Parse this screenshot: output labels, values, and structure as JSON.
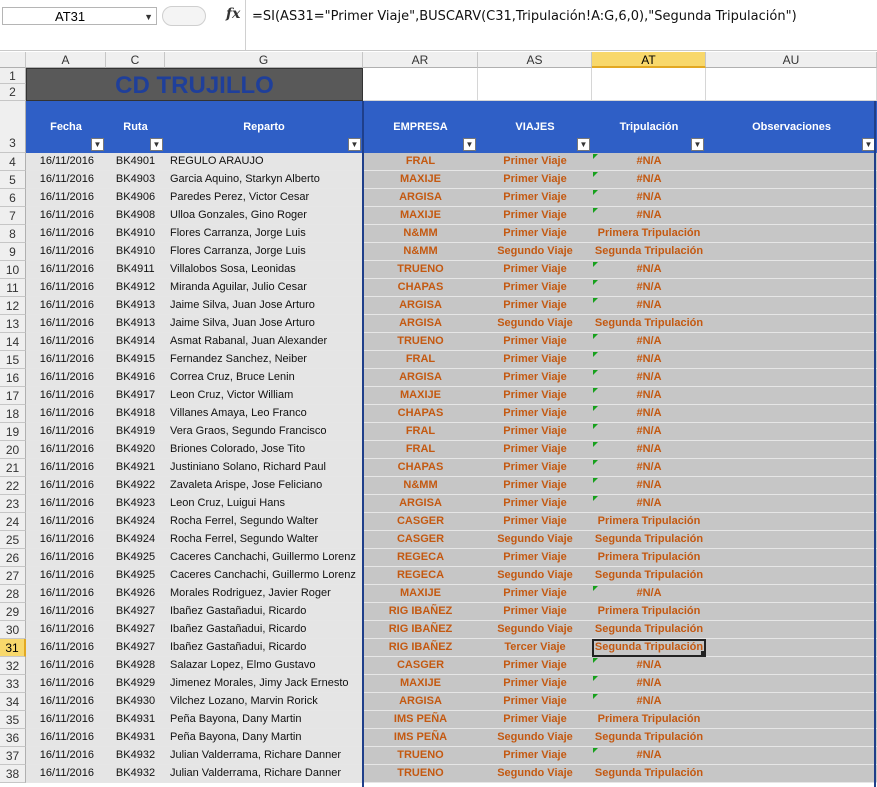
{
  "formula_bar": {
    "name_box": "AT31",
    "fx": "fx",
    "formula": "=SI(AS31=\"Primer Viaje\",BUSCARV(C31,Tripulación!A:G,6,0),\"Segunda Tripulación\")"
  },
  "columns": [
    "A",
    "C",
    "G",
    "AR",
    "AS",
    "AT",
    "AU"
  ],
  "active_column": "AT",
  "active_row": 31,
  "title": "CD TRUJILLO",
  "headers": {
    "fecha": "Fecha",
    "ruta": "Ruta",
    "reparto": "Reparto",
    "empresa": "EMPRESA",
    "viajes": "VIAJES",
    "tripulacion": "Tripulación",
    "observaciones": "Observaciones"
  },
  "filter_arrow": "▼",
  "row_numbers": [
    "1",
    "2",
    "3",
    "4",
    "5",
    "6",
    "7",
    "8",
    "9",
    "10",
    "11",
    "12",
    "13",
    "14",
    "15",
    "16",
    "17",
    "18",
    "19",
    "20",
    "21",
    "22",
    "23",
    "24",
    "25",
    "26",
    "27",
    "28",
    "29",
    "30",
    "31",
    "32",
    "33",
    "34",
    "35",
    "36",
    "37",
    "38"
  ],
  "rows": [
    {
      "fecha": "16/11/2016",
      "ruta": "BK4901",
      "reparto": "REGULO ARAUJO",
      "empresa": "FRAL",
      "viaje": "Primer Viaje",
      "trip": "#N/A"
    },
    {
      "fecha": "16/11/2016",
      "ruta": "BK4903",
      "reparto": "Garcia Aquino, Starkyn Alberto",
      "empresa": "MAXIJE",
      "viaje": "Primer Viaje",
      "trip": "#N/A"
    },
    {
      "fecha": "16/11/2016",
      "ruta": "BK4906",
      "reparto": "Paredes Perez, Victor Cesar",
      "empresa": "ARGISA",
      "viaje": "Primer Viaje",
      "trip": "#N/A"
    },
    {
      "fecha": "16/11/2016",
      "ruta": "BK4908",
      "reparto": "Ulloa Gonzales, Gino Roger",
      "empresa": "MAXIJE",
      "viaje": "Primer Viaje",
      "trip": "#N/A"
    },
    {
      "fecha": "16/11/2016",
      "ruta": "BK4910",
      "reparto": "Flores Carranza, Jorge Luis",
      "empresa": "N&MM",
      "viaje": "Primer Viaje",
      "trip": "Primera Tripulación"
    },
    {
      "fecha": "16/11/2016",
      "ruta": "BK4910",
      "reparto": "Flores Carranza, Jorge Luis",
      "empresa": "N&MM",
      "viaje": "Segundo Viaje",
      "trip": "Segunda Tripulación"
    },
    {
      "fecha": "16/11/2016",
      "ruta": "BK4911",
      "reparto": "Villalobos Sosa, Leonidas",
      "empresa": "TRUENO",
      "viaje": "Primer Viaje",
      "trip": "#N/A"
    },
    {
      "fecha": "16/11/2016",
      "ruta": "BK4912",
      "reparto": "Miranda Aguilar, Julio Cesar",
      "empresa": "CHAPAS",
      "viaje": "Primer Viaje",
      "trip": "#N/A"
    },
    {
      "fecha": "16/11/2016",
      "ruta": "BK4913",
      "reparto": "Jaime Silva, Juan Jose Arturo",
      "empresa": "ARGISA",
      "viaje": "Primer Viaje",
      "trip": "#N/A"
    },
    {
      "fecha": "16/11/2016",
      "ruta": "BK4913",
      "reparto": "Jaime Silva, Juan Jose Arturo",
      "empresa": "ARGISA",
      "viaje": "Segundo Viaje",
      "trip": "Segunda Tripulación"
    },
    {
      "fecha": "16/11/2016",
      "ruta": "BK4914",
      "reparto": "Asmat Rabanal, Juan Alexander",
      "empresa": "TRUENO",
      "viaje": "Primer Viaje",
      "trip": "#N/A"
    },
    {
      "fecha": "16/11/2016",
      "ruta": "BK4915",
      "reparto": "Fernandez Sanchez, Neiber",
      "empresa": "FRAL",
      "viaje": "Primer Viaje",
      "trip": "#N/A"
    },
    {
      "fecha": "16/11/2016",
      "ruta": "BK4916",
      "reparto": "Correa Cruz, Bruce Lenin",
      "empresa": "ARGISA",
      "viaje": "Primer Viaje",
      "trip": "#N/A"
    },
    {
      "fecha": "16/11/2016",
      "ruta": "BK4917",
      "reparto": "Leon Cruz, Victor William",
      "empresa": "MAXIJE",
      "viaje": "Primer Viaje",
      "trip": "#N/A"
    },
    {
      "fecha": "16/11/2016",
      "ruta": "BK4918",
      "reparto": "Villanes Amaya, Leo Franco",
      "empresa": "CHAPAS",
      "viaje": "Primer Viaje",
      "trip": "#N/A"
    },
    {
      "fecha": "16/11/2016",
      "ruta": "BK4919",
      "reparto": "Vera Graos, Segundo Francisco",
      "empresa": "FRAL",
      "viaje": "Primer Viaje",
      "trip": "#N/A"
    },
    {
      "fecha": "16/11/2016",
      "ruta": "BK4920",
      "reparto": "Briones Colorado, Jose Tito",
      "empresa": "FRAL",
      "viaje": "Primer Viaje",
      "trip": "#N/A"
    },
    {
      "fecha": "16/11/2016",
      "ruta": "BK4921",
      "reparto": "Justiniano Solano, Richard Paul",
      "empresa": "CHAPAS",
      "viaje": "Primer Viaje",
      "trip": "#N/A"
    },
    {
      "fecha": "16/11/2016",
      "ruta": "BK4922",
      "reparto": "Zavaleta Arispe, Jose Feliciano",
      "empresa": "N&MM",
      "viaje": "Primer Viaje",
      "trip": "#N/A"
    },
    {
      "fecha": "16/11/2016",
      "ruta": "BK4923",
      "reparto": "Leon Cruz, Luigui Hans",
      "empresa": "ARGISA",
      "viaje": "Primer Viaje",
      "trip": "#N/A"
    },
    {
      "fecha": "16/11/2016",
      "ruta": "BK4924",
      "reparto": "Rocha Ferrel, Segundo Walter",
      "empresa": "CASGER",
      "viaje": "Primer Viaje",
      "trip": "Primera Tripulación"
    },
    {
      "fecha": "16/11/2016",
      "ruta": "BK4924",
      "reparto": "Rocha Ferrel, Segundo Walter",
      "empresa": "CASGER",
      "viaje": "Segundo Viaje",
      "trip": "Segunda Tripulación"
    },
    {
      "fecha": "16/11/2016",
      "ruta": "BK4925",
      "reparto": "Caceres Canchachi, Guillermo Lorenz",
      "empresa": "REGECA",
      "viaje": "Primer Viaje",
      "trip": "Primera Tripulación"
    },
    {
      "fecha": "16/11/2016",
      "ruta": "BK4925",
      "reparto": "Caceres Canchachi, Guillermo Lorenz",
      "empresa": "REGECA",
      "viaje": "Segundo Viaje",
      "trip": "Segunda Tripulación"
    },
    {
      "fecha": "16/11/2016",
      "ruta": "BK4926",
      "reparto": "Morales Rodriguez, Javier Roger",
      "empresa": "MAXIJE",
      "viaje": "Primer Viaje",
      "trip": "#N/A"
    },
    {
      "fecha": "16/11/2016",
      "ruta": "BK4927",
      "reparto": "Ibañez Gastañadui, Ricardo",
      "empresa": "RIG IBAÑEZ",
      "viaje": "Primer Viaje",
      "trip": "Primera Tripulación"
    },
    {
      "fecha": "16/11/2016",
      "ruta": "BK4927",
      "reparto": "Ibañez Gastañadui, Ricardo",
      "empresa": "RIG IBAÑEZ",
      "viaje": "Segundo Viaje",
      "trip": "Segunda Tripulación"
    },
    {
      "fecha": "16/11/2016",
      "ruta": "BK4927",
      "reparto": "Ibañez Gastañadui, Ricardo",
      "empresa": "RIG IBAÑEZ",
      "viaje": "Tercer Viaje",
      "trip": "Segunda Tripulación"
    },
    {
      "fecha": "16/11/2016",
      "ruta": "BK4928",
      "reparto": "Salazar Lopez, Elmo Gustavo",
      "empresa": "CASGER",
      "viaje": "Primer Viaje",
      "trip": "#N/A"
    },
    {
      "fecha": "16/11/2016",
      "ruta": "BK4929",
      "reparto": "Jimenez Morales, Jimy Jack Ernesto",
      "empresa": "MAXIJE",
      "viaje": "Primer Viaje",
      "trip": "#N/A"
    },
    {
      "fecha": "16/11/2016",
      "ruta": "BK4930",
      "reparto": "Vilchez Lozano, Marvin Rorick",
      "empresa": "ARGISA",
      "viaje": "Primer Viaje",
      "trip": "#N/A"
    },
    {
      "fecha": "16/11/2016",
      "ruta": "BK4931",
      "reparto": "Peña Bayona, Dany Martin",
      "empresa": "IMS PEÑA",
      "viaje": "Primer Viaje",
      "trip": "Primera Tripulación"
    },
    {
      "fecha": "16/11/2016",
      "ruta": "BK4931",
      "reparto": "Peña Bayona, Dany Martin",
      "empresa": "IMS PEÑA",
      "viaje": "Segundo Viaje",
      "trip": "Segunda Tripulación"
    },
    {
      "fecha": "16/11/2016",
      "ruta": "BK4932",
      "reparto": "Julian Valderrama, Richare Danner",
      "empresa": "TRUENO",
      "viaje": "Primer Viaje",
      "trip": "#N/A"
    },
    {
      "fecha": "16/11/2016",
      "ruta": "BK4932",
      "reparto": "Julian Valderrama, Richare Danner",
      "empresa": "TRUENO",
      "viaje": "Segundo Viaje",
      "trip": "Segunda Tripulación"
    }
  ],
  "colors": {
    "header_blue": "#2f5fc6",
    "title_bg": "#595959",
    "title_text": "#1f3f9a",
    "orange_text": "#c45911",
    "error_indicator": "#16a11c",
    "selection_accent": "#f8d86b"
  }
}
